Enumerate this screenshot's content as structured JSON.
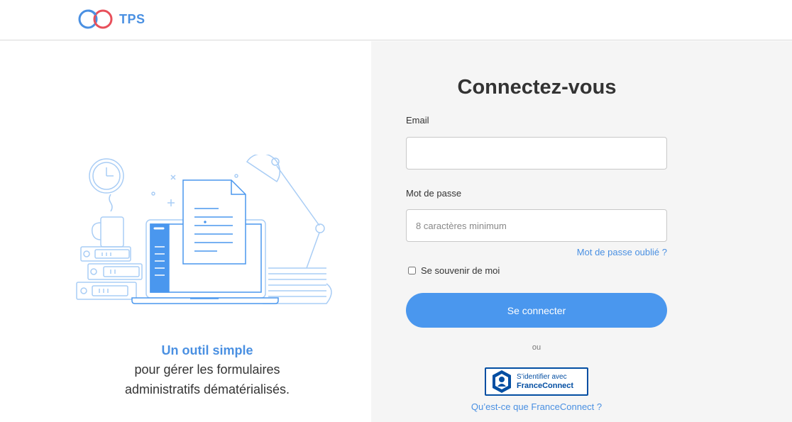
{
  "header": {
    "brand": "TPS"
  },
  "illustration": {
    "icon": "laptop-documents-illustration"
  },
  "tagline": {
    "highlight": "Un outil simple",
    "line2": "pour gérer les formulaires",
    "line3": "administratifs dématérialisés."
  },
  "login": {
    "title": "Connectez-vous",
    "email_label": "Email",
    "email_value": "",
    "password_label": "Mot de passe",
    "password_placeholder": "8 caractères minimum",
    "forgot_link": "Mot de passe oublié ?",
    "remember_label": "Se souvenir de moi",
    "remember_checked": false,
    "submit_label": "Se connecter",
    "or_text": "ou",
    "franceconnect_line1": "S’identifier avec",
    "franceconnect_line2": "FranceConnect",
    "franceconnect_help": "Qu’est-ce que FranceConnect ?"
  },
  "colors": {
    "accent": "#4a90e2",
    "button": "#4a97ee",
    "logo_red": "#e8505b",
    "franceconnect_blue": "#034ea2",
    "panel_bg": "#f5f5f5"
  }
}
